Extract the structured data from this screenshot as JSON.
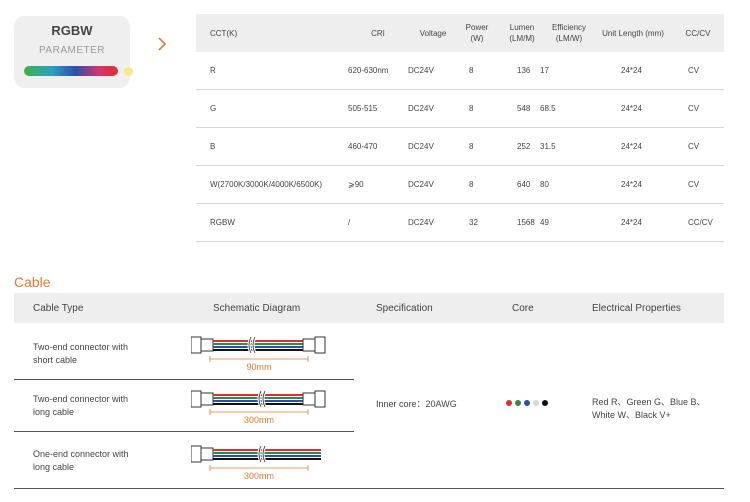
{
  "card": {
    "title": "RGBW",
    "subtitle": "PARAMETER"
  },
  "params": {
    "headers": [
      "CCT(K)",
      "CRI",
      "Voltage",
      "Power (W)",
      "Lumen (LM/M)",
      "Efficiency (LM/W)",
      "Unit Length (mm)",
      "CC/CV"
    ],
    "rows": [
      [
        "R",
        "620-630nm",
        "DC24V",
        "8",
        "136",
        "17",
        "24*24",
        "CV"
      ],
      [
        "G",
        "505-515",
        "DC24V",
        "8",
        "548",
        "68.5",
        "24*24",
        "CV"
      ],
      [
        "B",
        "460-470",
        "DC24V",
        "8",
        "252",
        "31.5",
        "24*24",
        "CV"
      ],
      [
        "W(2700K/3000K/4000K/6500K)",
        "⩾90",
        "DC24V",
        "8",
        "640",
        "80",
        "24*24",
        "CV"
      ],
      [
        "RGBW",
        "/",
        "DC24V",
        "32",
        "1568",
        "49",
        "24*24",
        "CC/CV"
      ]
    ]
  },
  "cable": {
    "title": "Cable",
    "headers": [
      "Cable Type",
      "Schematic Diagram",
      "Specification",
      "Core",
      "Electrical Properties"
    ],
    "rows": [
      {
        "type": "Two-end connector with short cable",
        "length": "90mm"
      },
      {
        "type": "Two-end connector with long cable",
        "length": "300mm"
      },
      {
        "type": "One-end connector with long cable",
        "length": "300mm"
      }
    ],
    "specification": "Inner core：20AWG",
    "core_colors": [
      "#e0302c",
      "#2e8a4a",
      "#2e4ea8",
      "#d8d8d8",
      "#111111"
    ],
    "electrical": "Red R、Green G、Blue B、White W、Black V+"
  },
  "colors": {
    "accent": "#e57a2c",
    "header_bg": "#eeeeee",
    "card_bg": "#efefef"
  }
}
